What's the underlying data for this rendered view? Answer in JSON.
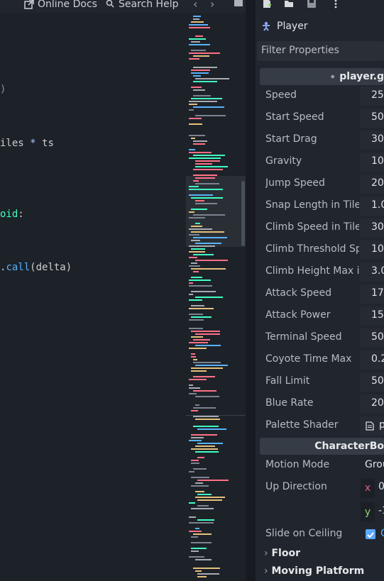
{
  "topbar": {
    "online_docs": "Online Docs",
    "search_help": "Search Help",
    "back_arrow": "‹",
    "forward_arrow": "›"
  },
  "editor": {
    "line_a": ")",
    "line_b_text": "iles ",
    "line_b_op": "*",
    "line_b_tail": " ts",
    "line_c_type": "oid",
    "line_c_tail": ":",
    "line_d_dot": ".",
    "line_d_fn": "call",
    "line_d_args": "(delta)"
  },
  "inspector": {
    "node_name": "Player",
    "filter_placeholder": "Filter Properties",
    "script_section": "player.g",
    "properties": [
      {
        "label": "Speed",
        "value": "25"
      },
      {
        "label": "Start Speed",
        "value": "50"
      },
      {
        "label": "Start Drag",
        "value": "30"
      },
      {
        "label": "Gravity",
        "value": "10"
      },
      {
        "label": "Jump Speed",
        "value": "20"
      },
      {
        "label": "Snap Length in Tile",
        "value": "1.0"
      },
      {
        "label": "Climb Speed in Tile",
        "value": "30"
      },
      {
        "label": "Climb Threshold Sp",
        "value": "10"
      },
      {
        "label": "Climb Height Max i",
        "value": "3.0"
      },
      {
        "label": "Attack Speed",
        "value": "17"
      },
      {
        "label": "Attack Power",
        "value": "15"
      },
      {
        "label": "Terminal Speed",
        "value": "50"
      },
      {
        "label": "Coyote Time Max",
        "value": "0.2"
      },
      {
        "label": "Fall Limit",
        "value": "50"
      },
      {
        "label": "Blue Rate",
        "value": "20"
      },
      {
        "label": "Palette Shader",
        "value": "p"
      }
    ],
    "body_section": "CharacterBo",
    "motion_mode": {
      "label": "Motion Mode",
      "value": "Grou"
    },
    "up_direction": {
      "label": "Up Direction",
      "x_label": "x",
      "x_value": "0",
      "y_label": "y",
      "y_value": "-1"
    },
    "slide_on_ceiling": {
      "label": "Slide on Ceiling",
      "value": "C"
    },
    "floor": "Floor",
    "moving_platform": "Moving Platform"
  },
  "colors": {
    "accent": "#5aa9ff",
    "node_icon": "#8da5f3",
    "vec_x": "#e0607e",
    "vec_y": "#8dd66d"
  }
}
